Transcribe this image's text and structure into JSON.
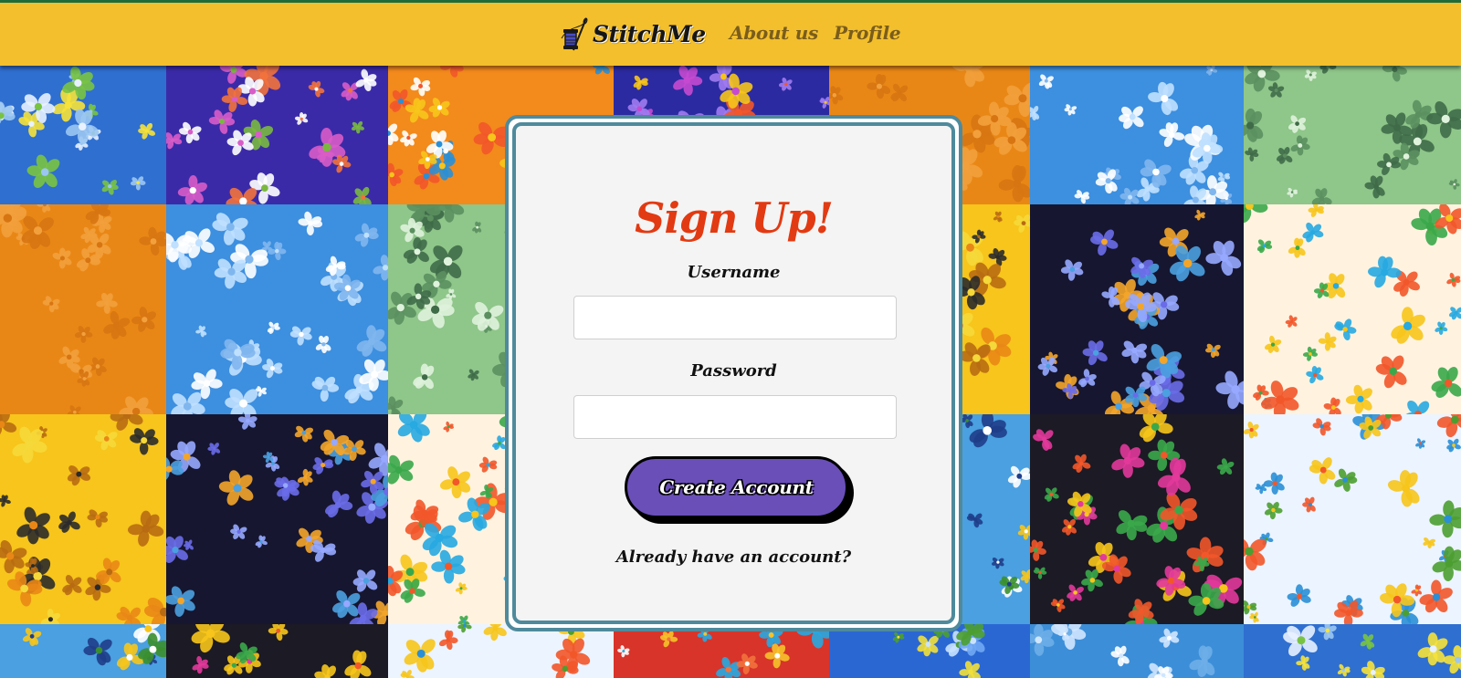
{
  "navbar": {
    "brand_name": "StitchMe",
    "brand_icon": "thread-spool-needle-icon",
    "links": [
      {
        "label": "About us"
      },
      {
        "label": "Profile"
      }
    ],
    "colors": {
      "background": "#f3bf2c",
      "link": "#7a5d1c",
      "top_border": "#1f6b3b"
    }
  },
  "signup": {
    "title": "Sign Up!",
    "username_label": "Username",
    "username_value": "",
    "password_label": "Password",
    "password_value": "",
    "submit_label": "Create Account",
    "login_prompt": "Already have an account?",
    "colors": {
      "title": "#e23a12",
      "card_border": "#4f8a9c",
      "card_background": "#f4f4f4",
      "button": "#6a4fb8"
    }
  },
  "background": {
    "description_icon": "floral-quilt-background"
  }
}
